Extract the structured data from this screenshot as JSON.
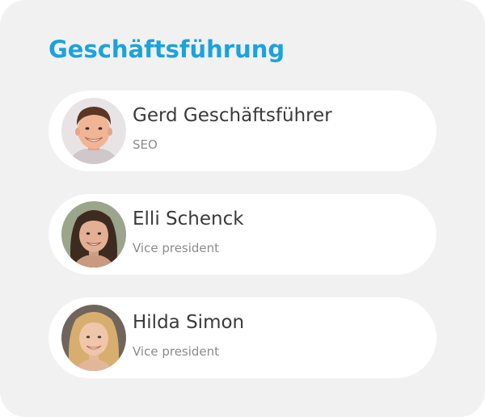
{
  "section": {
    "title": "Geschäftsführung"
  },
  "members": [
    {
      "name": "Gerd Geschäftsführer",
      "role": "SEO",
      "avatar_icon": "person-photo-male"
    },
    {
      "name": "Elli Schenck",
      "role": "Vice president",
      "avatar_icon": "person-photo-female-dark-hair"
    },
    {
      "name": "Hilda Simon",
      "role": "Vice president",
      "avatar_icon": "person-photo-female-blonde"
    }
  ],
  "colors": {
    "accent": "#1aa3dd",
    "card_background": "#f1f1f1",
    "item_background": "#ffffff",
    "name_text": "#3a3a3a",
    "role_text": "#8b8b8b"
  }
}
